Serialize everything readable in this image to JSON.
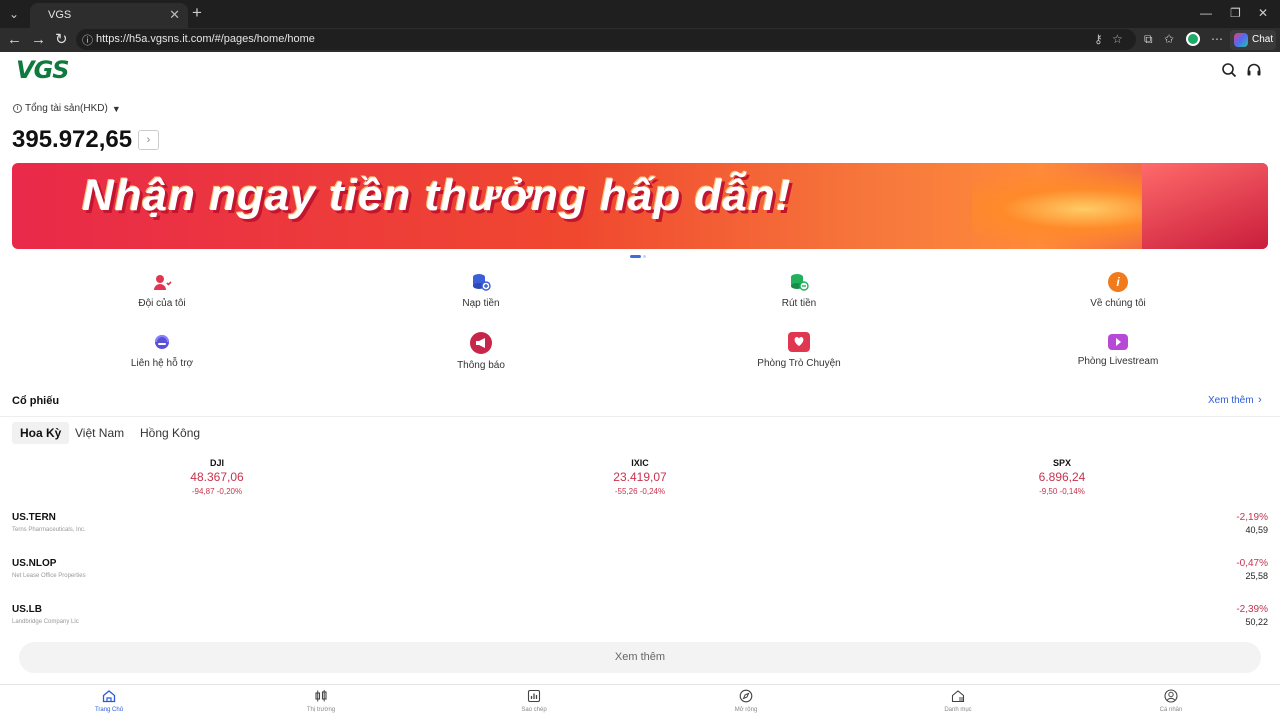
{
  "browser": {
    "tab_title": "VGS",
    "url": "https://h5a.vgsns.it.com/#/pages/home/home",
    "chat_label": "Chat"
  },
  "app": {
    "logo_text": "VGS",
    "asset_label": "Tổng tài sản(HKD)",
    "asset_value": "395.972,65",
    "banner_text": "Nhận ngay tiền thưởng hấp dẫn!"
  },
  "quick_actions": [
    {
      "label": "Đội của tôi",
      "icon": "team-icon",
      "color": "#e0364f"
    },
    {
      "label": "Nạp tiền",
      "icon": "deposit-icon",
      "color": "#3b5fd6"
    },
    {
      "label": "Rút tiền",
      "icon": "withdraw-icon",
      "color": "#21b15c"
    },
    {
      "label": "Về chúng tôi",
      "icon": "about-icon",
      "color": "#f07a1c"
    },
    {
      "label": "Liên hệ hỗ trợ",
      "icon": "support-icon",
      "color": "#5a4fd8"
    },
    {
      "label": "Thông báo",
      "icon": "announcement-icon",
      "color": "#c7264a"
    },
    {
      "label": "Phòng Trò Chuyện",
      "icon": "chat-room-icon",
      "color": "#e0364f"
    },
    {
      "label": "Phòng Livestream",
      "icon": "livestream-icon",
      "color": "#b64ad6"
    }
  ],
  "stocks": {
    "title": "Cổ phiếu",
    "see_more": "Xem thêm",
    "tabs": [
      "Hoa Kỳ",
      "Việt Nam",
      "Hồng Kông"
    ],
    "indices": [
      {
        "name": "DJI",
        "value": "48.367,06",
        "change": "-94,87 -0,20%"
      },
      {
        "name": "IXIC",
        "value": "23.419,07",
        "change": "-55,26 -0,24%"
      },
      {
        "name": "SPX",
        "value": "6.896,24",
        "change": "-9,50 -0,14%"
      }
    ],
    "rows": [
      {
        "symbol": "US.TERN",
        "name": "Terns Pharmaceuticals, Inc.",
        "pct": "-2,19%",
        "price": "40,59"
      },
      {
        "symbol": "US.NLOP",
        "name": "Net Lease Office Properties",
        "pct": "-0,47%",
        "price": "25,58"
      },
      {
        "symbol": "US.LB",
        "name": "Landbridge Company Llc",
        "pct": "-2,39%",
        "price": "50,22"
      }
    ],
    "more_button": "Xem thêm"
  },
  "bottom_nav": [
    {
      "label": "Trang Chủ",
      "icon": "home-icon"
    },
    {
      "label": "Thị trường",
      "icon": "market-icon"
    },
    {
      "label": "Sao chép",
      "icon": "copy-trade-icon"
    },
    {
      "label": "Mở rộng",
      "icon": "explore-icon"
    },
    {
      "label": "Danh mục",
      "icon": "portfolio-icon"
    },
    {
      "label": "Cá nhân",
      "icon": "profile-icon"
    }
  ],
  "colors": {
    "accent": "#2a5bd7",
    "negative": "#c7334e",
    "brand": "#0f7a3e"
  }
}
